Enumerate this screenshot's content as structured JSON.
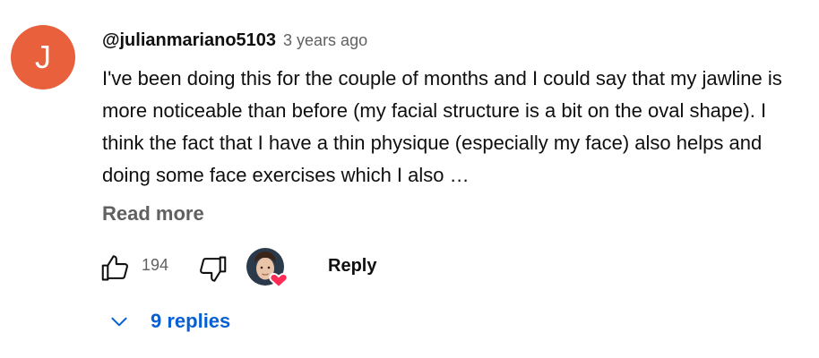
{
  "comment": {
    "avatar_letter": "J",
    "avatar_color": "#e8603c",
    "author": "@julianmariano5103",
    "time": "3 years ago",
    "text": "I've been doing this for the couple of months and I could say that my jawline is more noticeable than before (my facial structure is a bit on the oval shape). I think the fact that I have a thin physique (especially my face) also helps and doing some face exercises which I also …",
    "read_more": "Read more",
    "like_count": "194",
    "reply_label": "Reply",
    "replies_label": "9 replies",
    "accent_color": "#065fd4",
    "heart_color": "#ff2d55",
    "icons": [
      "thumbs-up-icon",
      "thumbs-down-icon",
      "creator-heart-icon",
      "chevron-down-icon"
    ]
  }
}
